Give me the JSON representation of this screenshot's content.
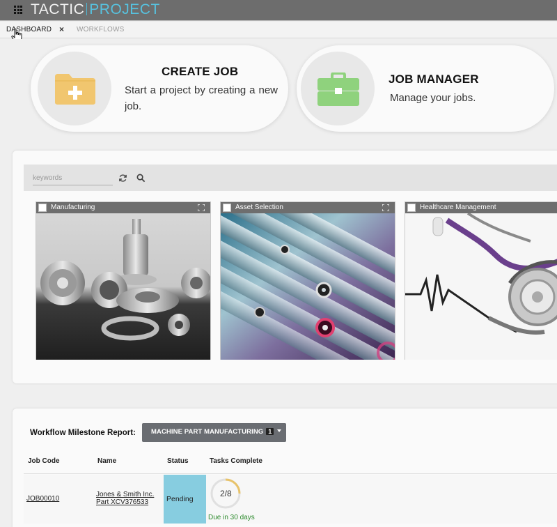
{
  "app": {
    "brand_left": "TACTIC",
    "brand_right": "PROJECT"
  },
  "tabs": [
    {
      "label": "DASHBOARD",
      "active": true
    },
    {
      "label": "WORKFLOWS",
      "active": false
    }
  ],
  "tab_close_glyph": "×",
  "cards": {
    "create": {
      "title": "CREATE JOB",
      "description": "Start a project by creating a new job.",
      "icon": "folder-plus-icon",
      "icon_color": "#f1c66f"
    },
    "manager": {
      "title": "JOB MANAGER",
      "description": "Manage your jobs.",
      "icon": "briefcase-icon",
      "icon_color": "#8fd27d"
    }
  },
  "search": {
    "placeholder": "keywords",
    "value": ""
  },
  "workflows": [
    {
      "label": "Manufacturing",
      "image": "machined-parts-photo"
    },
    {
      "label": "Asset Selection",
      "image": "server-rack-photo"
    },
    {
      "label": "Healthcare Management",
      "image": "stethoscope-photo"
    }
  ],
  "report": {
    "label": "Workflow Milestone Report:",
    "dropdown_label": "MACHINE PART MANUFACTURING",
    "dropdown_badge": "1",
    "columns": [
      "Job Code",
      "Name",
      "Status",
      "Tasks Complete"
    ],
    "rows": [
      {
        "job_code": "JOB00010",
        "name_line1": "Jones & Smith Inc.",
        "name_line2": "Part XCV376533",
        "status": "Pending",
        "tasks_complete": "2/8",
        "tasks_fraction": 0.25,
        "due": "Due in 30 days"
      }
    ]
  },
  "colors": {
    "status_pending": "#87cde0",
    "accent": "#57c2df",
    "due": "#2e8b2e"
  }
}
